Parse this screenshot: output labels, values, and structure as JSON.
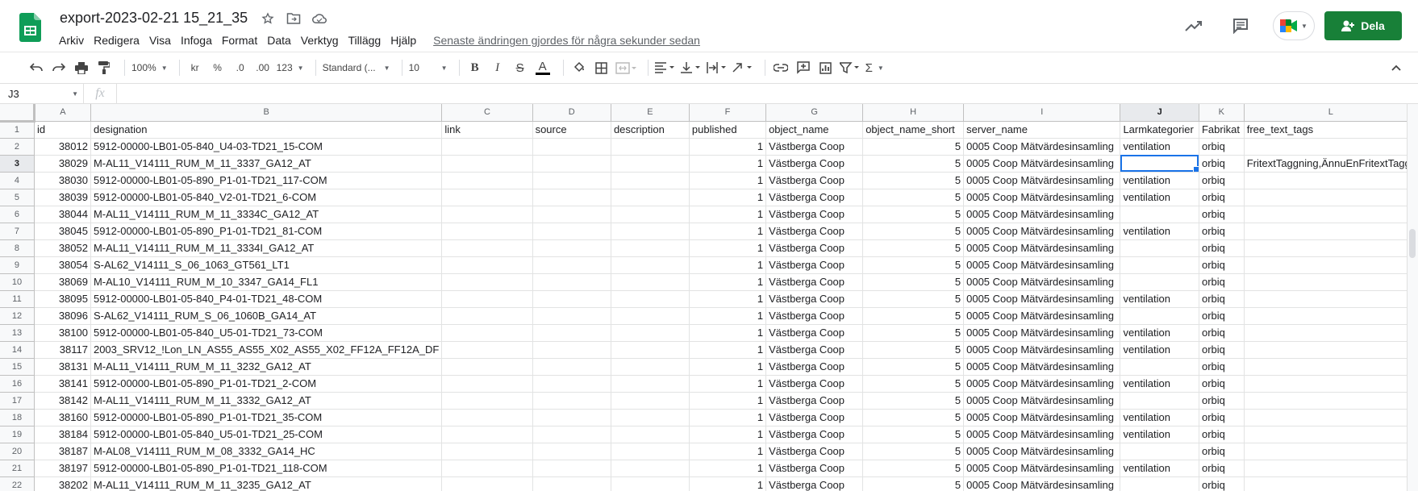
{
  "doc_title": "export-2023-02-21 15_21_35",
  "menu": [
    "Arkiv",
    "Redigera",
    "Visa",
    "Infoga",
    "Format",
    "Data",
    "Verktyg",
    "Tillägg",
    "Hjälp"
  ],
  "last_edit": "Senaste ändringen gjordes för några sekunder sedan",
  "share_label": "Dela",
  "toolbar": {
    "zoom": "100%",
    "currency": "kr",
    "percent": "%",
    "dec_less": ".0",
    "dec_more": ".00",
    "more_formats": "123",
    "font": "Standard (...",
    "font_size": "10",
    "bold": "B",
    "italic": "I",
    "strike": "S",
    "text_color": "A",
    "sigma": "Σ"
  },
  "name_box": "J3",
  "fx": "fx",
  "columns": [
    "A",
    "B",
    "C",
    "D",
    "E",
    "F",
    "G",
    "H",
    "I",
    "J",
    "K",
    "L"
  ],
  "rows": [
    [
      "id",
      "designation",
      "link",
      "source",
      "description",
      "published",
      "object_name",
      "object_name_short",
      "server_name",
      "Larmkategorier",
      "Fabrikat",
      "free_text_tags"
    ],
    [
      "38012",
      "5912-00000-LB01-05-840_U4-03-TD21_15-COM",
      "",
      "",
      "",
      "1",
      "Västberga Coop",
      "5",
      "0005 Coop Mätvärdesinsamling",
      "ventilation",
      "orbiq",
      ""
    ],
    [
      "38029",
      "M-AL11_V14111_RUM_M_11_3337_GA12_AT",
      "",
      "",
      "",
      "1",
      "Västberga Coop",
      "5",
      "0005 Coop Mätvärdesinsamling",
      "",
      "orbiq",
      "FritextTaggning,ÄnnuEnFritextTagg"
    ],
    [
      "38030",
      "5912-00000-LB01-05-890_P1-01-TD21_117-COM",
      "",
      "",
      "",
      "1",
      "Västberga Coop",
      "5",
      "0005 Coop Mätvärdesinsamling",
      "ventilation",
      "orbiq",
      ""
    ],
    [
      "38039",
      "5912-00000-LB01-05-840_V2-01-TD21_6-COM",
      "",
      "",
      "",
      "1",
      "Västberga Coop",
      "5",
      "0005 Coop Mätvärdesinsamling",
      "ventilation",
      "orbiq",
      ""
    ],
    [
      "38044",
      "M-AL11_V14111_RUM_M_11_3334C_GA12_AT",
      "",
      "",
      "",
      "1",
      "Västberga Coop",
      "5",
      "0005 Coop Mätvärdesinsamling",
      "",
      "orbiq",
      ""
    ],
    [
      "38045",
      "5912-00000-LB01-05-890_P1-01-TD21_81-COM",
      "",
      "",
      "",
      "1",
      "Västberga Coop",
      "5",
      "0005 Coop Mätvärdesinsamling",
      "ventilation",
      "orbiq",
      ""
    ],
    [
      "38052",
      "M-AL11_V14111_RUM_M_11_3334I_GA12_AT",
      "",
      "",
      "",
      "1",
      "Västberga Coop",
      "5",
      "0005 Coop Mätvärdesinsamling",
      "",
      "orbiq",
      ""
    ],
    [
      "38054",
      "S-AL62_V14111_S_06_1063_GT561_LT1",
      "",
      "",
      "",
      "1",
      "Västberga Coop",
      "5",
      "0005 Coop Mätvärdesinsamling",
      "",
      "orbiq",
      ""
    ],
    [
      "38069",
      "M-AL10_V14111_RUM_M_10_3347_GA14_FL1",
      "",
      "",
      "",
      "1",
      "Västberga Coop",
      "5",
      "0005 Coop Mätvärdesinsamling",
      "",
      "orbiq",
      ""
    ],
    [
      "38095",
      "5912-00000-LB01-05-840_P4-01-TD21_48-COM",
      "",
      "",
      "",
      "1",
      "Västberga Coop",
      "5",
      "0005 Coop Mätvärdesinsamling",
      "ventilation",
      "orbiq",
      ""
    ],
    [
      "38096",
      "S-AL62_V14111_RUM_S_06_1060B_GA14_AT",
      "",
      "",
      "",
      "1",
      "Västberga Coop",
      "5",
      "0005 Coop Mätvärdesinsamling",
      "",
      "orbiq",
      ""
    ],
    [
      "38100",
      "5912-00000-LB01-05-840_U5-01-TD21_73-COM",
      "",
      "",
      "",
      "1",
      "Västberga Coop",
      "5",
      "0005 Coop Mätvärdesinsamling",
      "ventilation",
      "orbiq",
      ""
    ],
    [
      "38117",
      "2003_SRV12_!Lon_LN_AS55_AS55_X02_AS55_X02_FF12A_FF12A_DF",
      "",
      "",
      "",
      "1",
      "Västberga Coop",
      "5",
      "0005 Coop Mätvärdesinsamling",
      "ventilation",
      "orbiq",
      ""
    ],
    [
      "38131",
      "M-AL11_V14111_RUM_M_11_3232_GA12_AT",
      "",
      "",
      "",
      "1",
      "Västberga Coop",
      "5",
      "0005 Coop Mätvärdesinsamling",
      "",
      "orbiq",
      ""
    ],
    [
      "38141",
      "5912-00000-LB01-05-890_P1-01-TD21_2-COM",
      "",
      "",
      "",
      "1",
      "Västberga Coop",
      "5",
      "0005 Coop Mätvärdesinsamling",
      "ventilation",
      "orbiq",
      ""
    ],
    [
      "38142",
      "M-AL11_V14111_RUM_M_11_3332_GA12_AT",
      "",
      "",
      "",
      "1",
      "Västberga Coop",
      "5",
      "0005 Coop Mätvärdesinsamling",
      "",
      "orbiq",
      ""
    ],
    [
      "38160",
      "5912-00000-LB01-05-890_P1-01-TD21_35-COM",
      "",
      "",
      "",
      "1",
      "Västberga Coop",
      "5",
      "0005 Coop Mätvärdesinsamling",
      "ventilation",
      "orbiq",
      ""
    ],
    [
      "38184",
      "5912-00000-LB01-05-840_U5-01-TD21_25-COM",
      "",
      "",
      "",
      "1",
      "Västberga Coop",
      "5",
      "0005 Coop Mätvärdesinsamling",
      "ventilation",
      "orbiq",
      ""
    ],
    [
      "38187",
      "M-AL08_V14111_RUM_M_08_3332_GA14_HC",
      "",
      "",
      "",
      "1",
      "Västberga Coop",
      "5",
      "0005 Coop Mätvärdesinsamling",
      "",
      "orbiq",
      ""
    ],
    [
      "38197",
      "5912-00000-LB01-05-890_P1-01-TD21_118-COM",
      "",
      "",
      "",
      "1",
      "Västberga Coop",
      "5",
      "0005 Coop Mätvärdesinsamling",
      "ventilation",
      "orbiq",
      ""
    ],
    [
      "38202",
      "M-AL11_V14111_RUM_M_11_3235_GA12_AT",
      "",
      "",
      "",
      "1",
      "Västberga Coop",
      "5",
      "0005 Coop Mätvärdesinsamling",
      "",
      "orbiq",
      ""
    ]
  ],
  "active_cell": {
    "row": 3,
    "col": "J"
  },
  "colors": {
    "accent": "#1a73e8",
    "share": "#188038",
    "sheets_green": "#0f9d58"
  }
}
